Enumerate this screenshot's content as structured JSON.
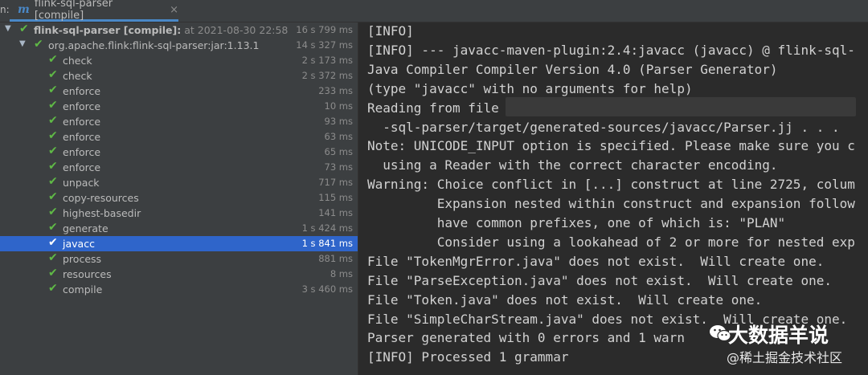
{
  "tabbar": {
    "prefix": "n:",
    "tab_label": "flink-sql-parser [compile]",
    "close_glyph": "×",
    "icon": "maven-icon"
  },
  "tree": {
    "root": {
      "name": "flink-sql-parser [compile]:",
      "extra": " at 2021-08-30 22:58",
      "time": "16 s 799 ms"
    },
    "artifact": {
      "name": "org.apache.flink:flink-sql-parser:jar:1.13.1",
      "time": "14 s 327 ms"
    },
    "goals": [
      {
        "name": "check",
        "time": "2 s 173 ms"
      },
      {
        "name": "check",
        "time": "2 s 372 ms"
      },
      {
        "name": "enforce",
        "time": "233 ms"
      },
      {
        "name": "enforce",
        "time": "10 ms"
      },
      {
        "name": "enforce",
        "time": "93 ms"
      },
      {
        "name": "enforce",
        "time": "63 ms"
      },
      {
        "name": "enforce",
        "time": "65 ms"
      },
      {
        "name": "enforce",
        "time": "73 ms"
      },
      {
        "name": "unpack",
        "time": "717 ms"
      },
      {
        "name": "copy-resources",
        "time": "115 ms"
      },
      {
        "name": "highest-basedir",
        "time": "141 ms"
      },
      {
        "name": "generate",
        "time": "1 s 424 ms"
      },
      {
        "name": "javacc",
        "time": "1 s 841 ms"
      },
      {
        "name": "process",
        "time": "881 ms"
      },
      {
        "name": "resources",
        "time": "8 ms"
      },
      {
        "name": "compile",
        "time": "3 s 460 ms"
      }
    ],
    "selected_goal": "javacc"
  },
  "console": {
    "lines": [
      "[INFO]",
      "[INFO] --- javacc-maven-plugin:2.4:javacc (javacc) @ flink-sql-",
      "Java Compiler Compiler Version 4.0 (Parser Generator)",
      "(type \"javacc\" with no arguments for help)",
      "Reading from file                                          /f",
      "  -sql-parser/target/generated-sources/javacc/Parser.jj . . .",
      "Note: UNICODE_INPUT option is specified. Please make sure you c",
      "  using a Reader with the correct character encoding.",
      "Warning: Choice conflict in [...] construct at line 2725, colum",
      "         Expansion nested within construct and expansion follow",
      "         have common prefixes, one of which is: \"PLAN\"",
      "         Consider using a lookahead of 2 or more for nested exp",
      "File \"TokenMgrError.java\" does not exist.  Will create one.",
      "File \"ParseException.java\" does not exist.  Will create one.",
      "File \"Token.java\" does not exist.  Will create one.",
      "File \"SimpleCharStream.java\" does not exist.  Will create one.",
      "Parser generated with 0 errors and 1 warn",
      "[INFO] Processed 1 grammar"
    ]
  },
  "watermark": {
    "title": "大数据羊说",
    "subtitle": "@稀土掘金技术社区",
    "icon": "wechat-icon"
  },
  "colors": {
    "check_green": "#5fb946",
    "selection_blue": "#2f65ca",
    "tab_underline": "#4a88c7"
  }
}
